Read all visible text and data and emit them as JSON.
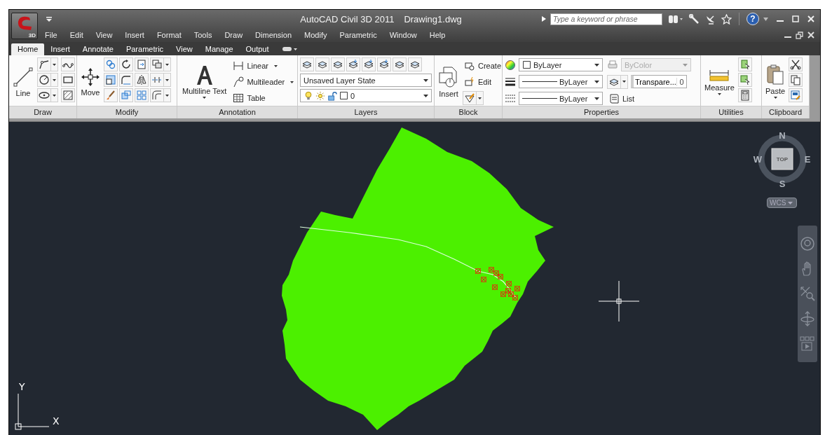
{
  "app_button": {
    "badge": "3D"
  },
  "title": "AutoCAD Civil 3D 2011",
  "document": "Drawing1.dwg",
  "search": {
    "placeholder": "Type a keyword or phrase"
  },
  "help": "?",
  "menu": [
    {
      "label": "File"
    },
    {
      "label": "Edit"
    },
    {
      "label": "View"
    },
    {
      "label": "Insert"
    },
    {
      "label": "Format"
    },
    {
      "label": "Tools"
    },
    {
      "label": "Draw"
    },
    {
      "label": "Dimension"
    },
    {
      "label": "Modify"
    },
    {
      "label": "Parametric"
    },
    {
      "label": "Window"
    },
    {
      "label": "Help"
    }
  ],
  "ribbon_tabs": [
    {
      "label": "Home",
      "selected": true
    },
    {
      "label": "Insert",
      "selected": false
    },
    {
      "label": "Annotate",
      "selected": false
    },
    {
      "label": "Parametric",
      "selected": false
    },
    {
      "label": "View",
      "selected": false
    },
    {
      "label": "Manage",
      "selected": false
    },
    {
      "label": "Output",
      "selected": false
    }
  ],
  "ribbon": {
    "draw": {
      "title": "Draw",
      "command": "Line"
    },
    "modify": {
      "title": "Modify",
      "command": "Move"
    },
    "annotation": {
      "title": "Annotation",
      "command": "Multiline Text",
      "items": [
        {
          "label": "Linear",
          "dropdown": true
        },
        {
          "label": "Multileader",
          "dropdown": true
        },
        {
          "label": "Table",
          "dropdown": false
        }
      ]
    },
    "layers": {
      "title": "Layers",
      "layer_state": "Unsaved Layer State",
      "layer": "0"
    },
    "block": {
      "title": "Block",
      "command": "Insert",
      "items": [
        "Create",
        "Edit"
      ]
    },
    "properties": {
      "title": "Properties",
      "object_color": "ByLayer",
      "lineweight": "ByLayer",
      "linetype": "ByLayer",
      "plot_style": {
        "value": "ByColor",
        "disabled": true
      },
      "transparency": {
        "label": "Transpare...",
        "value": "0"
      },
      "list": "List"
    },
    "utilities": {
      "title": "Utilities",
      "command": "Measure"
    },
    "clipboard": {
      "title": "Clipboard",
      "command": "Paste"
    }
  },
  "viewcube": {
    "north": "N",
    "west": "W",
    "east": "E",
    "south": "S",
    "face": "TOP",
    "ucs": "WCS"
  },
  "ucs_icon": {
    "x": "X",
    "y": "Y"
  }
}
